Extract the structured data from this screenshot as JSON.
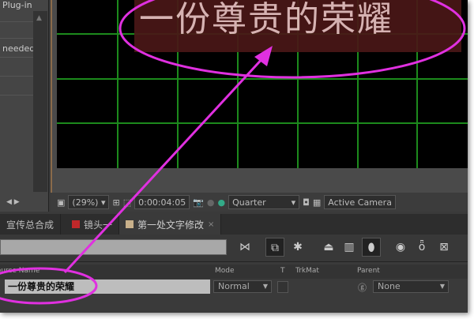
{
  "left_panel": {
    "header_text": "Plug-in",
    "row_text": "needed"
  },
  "viewer": {
    "banner_text": "一份尊贵的荣耀",
    "zoom": "(29%)",
    "timecode": "0:00:04:05",
    "resolution": "Quarter",
    "camera": "Active Camera"
  },
  "tabs": [
    {
      "label": "宣传总合成",
      "color": null
    },
    {
      "label": "镜头一",
      "color": "#c0282a"
    },
    {
      "label": "第一处文字修改",
      "color": "#c8b08a",
      "close": "×"
    }
  ],
  "columns": {
    "source_name": "Source Name",
    "mode": "Mode",
    "t": "T",
    "trkmat": "TrkMat",
    "parent": "Parent"
  },
  "layer": {
    "name": "一份尊贵的荣耀",
    "mode": "Normal",
    "parent": "None"
  },
  "annotation_color": "#e030e0"
}
